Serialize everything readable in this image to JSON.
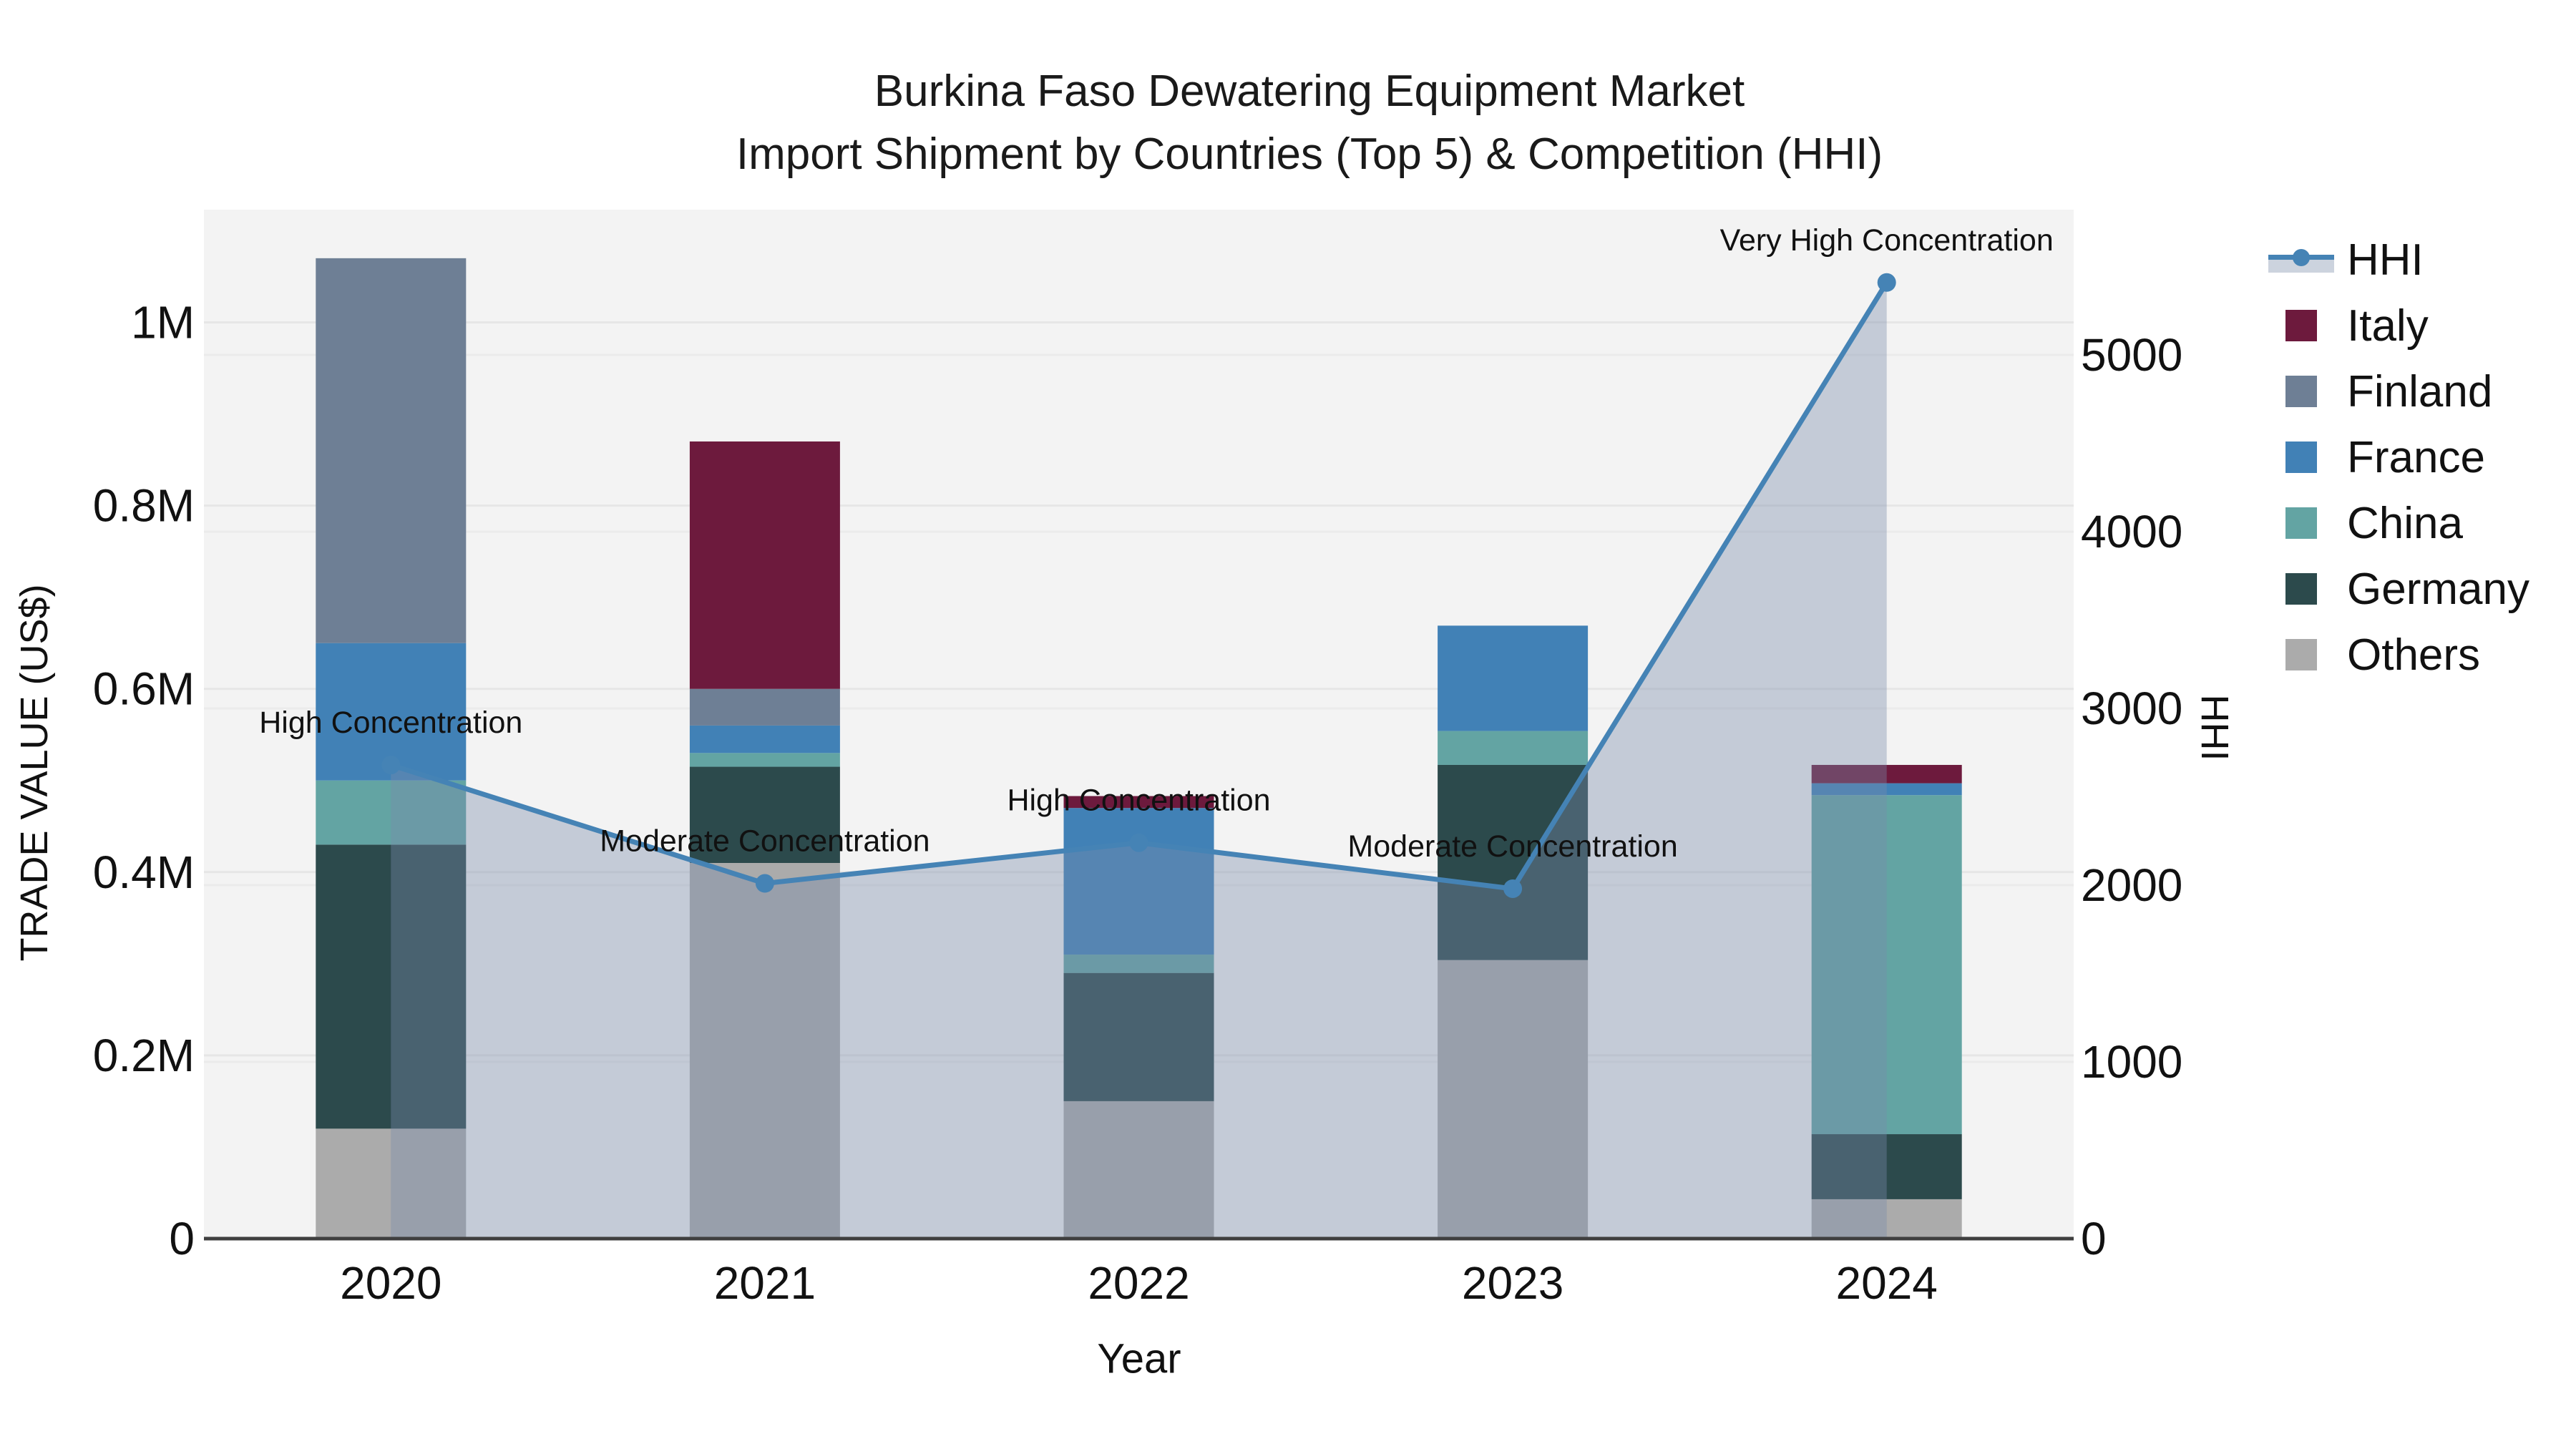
{
  "title": {
    "line1": "Burkina Faso Dewatering Equipment Market",
    "line2": "Import Shipment by Countries (Top 5) & Competition (HHI)"
  },
  "axes": {
    "x": {
      "title": "Year"
    },
    "y_left": {
      "title": "TRADE VALUE (US$)"
    },
    "y_right": {
      "title": "HHI"
    }
  },
  "legend": {
    "items": [
      {
        "label": "HHI",
        "type": "line",
        "color": "#4583b5",
        "fill": "#ccd3de"
      },
      {
        "label": "Italy",
        "type": "square",
        "color": "#6d1a3d"
      },
      {
        "label": "Finland",
        "type": "square",
        "color": "#6e7f95"
      },
      {
        "label": "France",
        "type": "square",
        "color": "#4181b6"
      },
      {
        "label": "China",
        "type": "square",
        "color": "#63a4a3"
      },
      {
        "label": "Germany",
        "type": "square",
        "color": "#2c4a4c"
      },
      {
        "label": "Others",
        "type": "square",
        "color": "#ababab"
      }
    ]
  },
  "chart_data": {
    "type": "bar+line",
    "title": "Burkina Faso Dewatering Equipment Market — Import Shipment by Countries (Top 5) & Competition (HHI)",
    "categories": [
      "2020",
      "2021",
      "2022",
      "2023",
      "2024"
    ],
    "stack_order_bottom_to_top": [
      "Others",
      "Germany",
      "China",
      "France",
      "Finland",
      "Italy"
    ],
    "series": [
      {
        "name": "Others",
        "color": "#ababab",
        "values": [
          120000,
          410000,
          150000,
          304000,
          43000
        ]
      },
      {
        "name": "Germany",
        "color": "#2c4a4c",
        "values": [
          310000,
          105000,
          140000,
          213000,
          71000
        ]
      },
      {
        "name": "China",
        "color": "#63a4a3",
        "values": [
          70000,
          15000,
          20000,
          37000,
          370000
        ]
      },
      {
        "name": "France",
        "color": "#4181b6",
        "values": [
          150000,
          30000,
          160000,
          115000,
          13000
        ]
      },
      {
        "name": "Finland",
        "color": "#6e7f95",
        "values": [
          420000,
          40000,
          0,
          0,
          0
        ]
      },
      {
        "name": "Italy",
        "color": "#6d1a3d",
        "values": [
          0,
          270000,
          13000,
          0,
          20000
        ]
      }
    ],
    "line": {
      "name": "HHI",
      "color": "#4583b5",
      "area_fill": "rgba(122,140,170,0.38)",
      "values": [
        2680,
        2010,
        2240,
        1980,
        5410
      ]
    },
    "annotations": [
      {
        "category": "2020",
        "text": "High Concentration"
      },
      {
        "category": "2021",
        "text": "Moderate Concentration"
      },
      {
        "category": "2022",
        "text": "High Concentration"
      },
      {
        "category": "2023",
        "text": "Moderate Concentration"
      },
      {
        "category": "2024",
        "text": "Very High Concentration"
      }
    ],
    "xlabel": "Year",
    "ylabel_left": "TRADE VALUE (US$)",
    "ylabel_right": "HHI",
    "left_axis": {
      "ticks": [
        {
          "value": 0,
          "label": "0"
        },
        {
          "value": 200000,
          "label": "0.2M"
        },
        {
          "value": 400000,
          "label": "0.4M"
        },
        {
          "value": 600000,
          "label": "0.6M"
        },
        {
          "value": 800000,
          "label": "0.8M"
        },
        {
          "value": 1000000,
          "label": "1M"
        }
      ],
      "range": [
        0,
        1123000
      ]
    },
    "right_axis": {
      "ticks": [
        {
          "value": 0,
          "label": "0"
        },
        {
          "value": 1000,
          "label": "1000"
        },
        {
          "value": 2000,
          "label": "2000"
        },
        {
          "value": 3000,
          "label": "3000"
        },
        {
          "value": 4000,
          "label": "4000"
        },
        {
          "value": 5000,
          "label": "5000"
        }
      ],
      "range": [
        0,
        5822
      ]
    },
    "grid": true,
    "legend_position": "right",
    "plot_background": "#f3f3f3",
    "gridline_color": "#e6e6e6",
    "axisline_color": "#3f3f3f"
  }
}
